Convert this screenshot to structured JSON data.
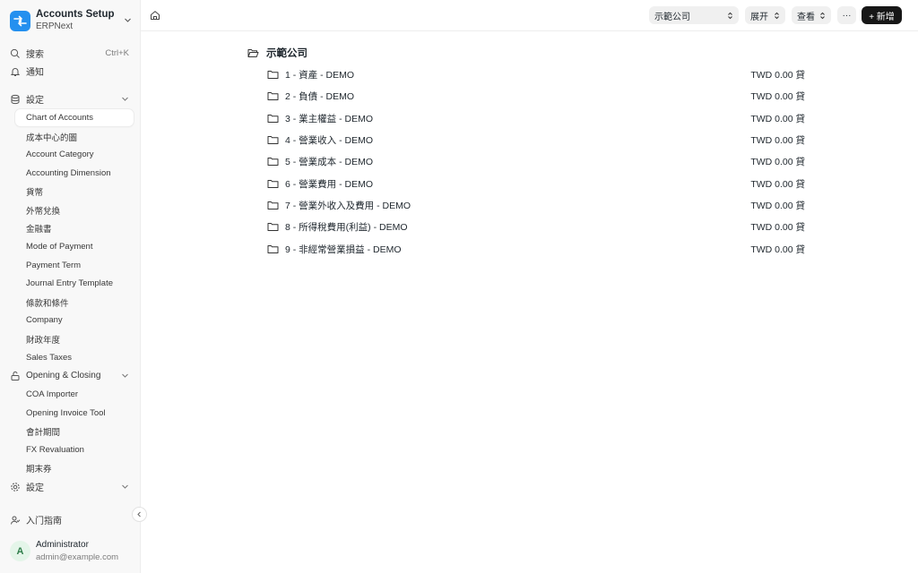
{
  "app": {
    "title": "Accounts Setup",
    "subtitle": "ERPNext"
  },
  "sidebar": {
    "search_label": "搜索",
    "search_shortcut": "Ctrl+K",
    "notifications_label": "通知",
    "section_settings": "設定",
    "settings_items": [
      "Chart of Accounts",
      "成本中心的圖",
      "Account Category",
      "Accounting Dimension",
      "貨幣",
      "外幣兌換",
      "金融書",
      "Mode of Payment",
      "Payment Term",
      "Journal Entry Template",
      "條款和條件",
      "Company",
      "財政年度",
      "Sales Taxes"
    ],
    "section_opening": "Opening & Closing",
    "opening_items": [
      "COA Importer",
      "Opening Invoice Tool",
      "會計期間",
      "FX Revaluation",
      "期末券"
    ],
    "section_settings2": "設定",
    "getting_started": "入门指南"
  },
  "user": {
    "initial": "A",
    "name": "Administrator",
    "email": "admin@example.com"
  },
  "toolbar": {
    "company": "示範公司",
    "expand": "展开",
    "view": "查看",
    "more": "···",
    "new": "+ 新增"
  },
  "tree": {
    "root": "示範公司",
    "rows": [
      {
        "name": "1 - 資產 - DEMO",
        "balance": "TWD 0.00 貸"
      },
      {
        "name": "2 - 負債 - DEMO",
        "balance": "TWD 0.00 貸"
      },
      {
        "name": "3 - 業主權益 - DEMO",
        "balance": "TWD 0.00 貸"
      },
      {
        "name": "4 - 營業收入 - DEMO",
        "balance": "TWD 0.00 貸"
      },
      {
        "name": "5 - 營業成本 - DEMO",
        "balance": "TWD 0.00 貸"
      },
      {
        "name": "6 - 營業費用 - DEMO",
        "balance": "TWD 0.00 貸"
      },
      {
        "name": "7 - 營業外收入及費用 - DEMO",
        "balance": "TWD 0.00 貸"
      },
      {
        "name": "8 - 所得稅費用(利益) - DEMO",
        "balance": "TWD 0.00 貸"
      },
      {
        "name": "9 - 非經常營業損益 - DEMO",
        "balance": "TWD 0.00 貸"
      }
    ]
  }
}
